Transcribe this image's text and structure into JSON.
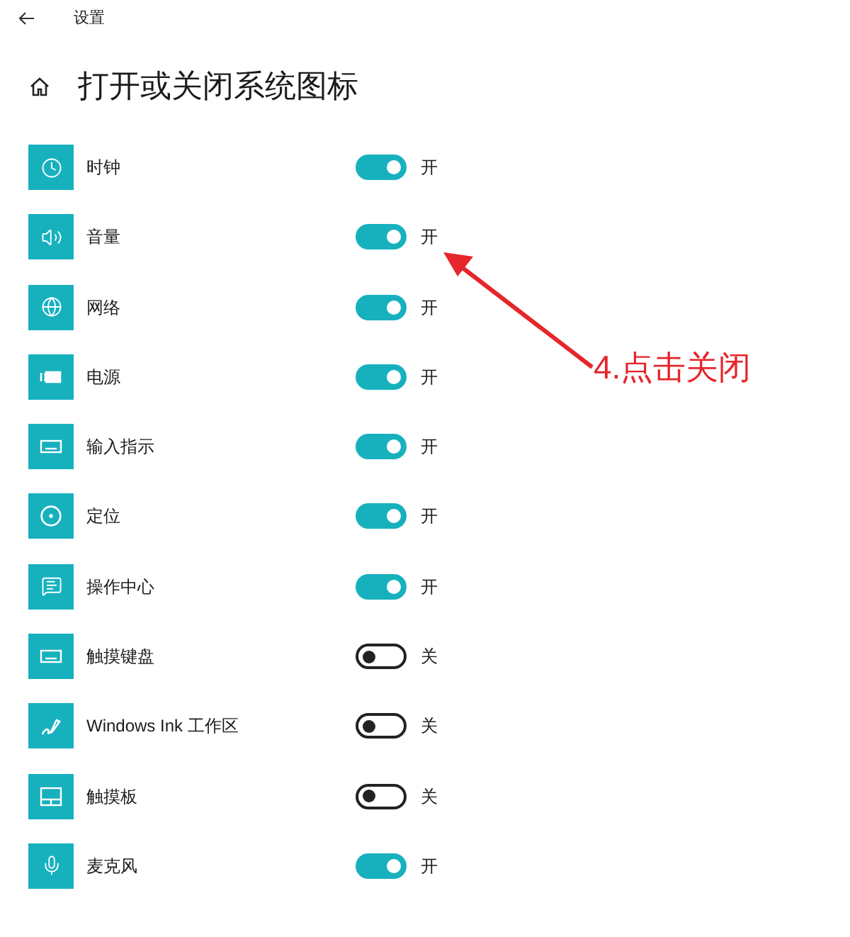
{
  "window": {
    "title": "设置"
  },
  "page": {
    "title": "打开或关闭系统图标"
  },
  "items": [
    {
      "kind": "clock",
      "label": "时钟",
      "on": true,
      "state_label": "开"
    },
    {
      "kind": "volume",
      "label": "音量",
      "on": true,
      "state_label": "开"
    },
    {
      "kind": "network",
      "label": "网络",
      "on": true,
      "state_label": "开"
    },
    {
      "kind": "power",
      "label": "电源",
      "on": true,
      "state_label": "开"
    },
    {
      "kind": "input",
      "label": "输入指示",
      "on": true,
      "state_label": "开"
    },
    {
      "kind": "location",
      "label": "定位",
      "on": true,
      "state_label": "开"
    },
    {
      "kind": "action_center",
      "label": "操作中心",
      "on": true,
      "state_label": "开"
    },
    {
      "kind": "touch_keyboard",
      "label": "触摸键盘",
      "on": false,
      "state_label": "关"
    },
    {
      "kind": "ink",
      "label": "Windows Ink 工作区",
      "on": false,
      "state_label": "关"
    },
    {
      "kind": "touchpad",
      "label": "触摸板",
      "on": false,
      "state_label": "关"
    },
    {
      "kind": "microphone",
      "label": "麦克风",
      "on": true,
      "state_label": "开"
    }
  ],
  "annotation": {
    "text": "4.点击关闭"
  }
}
